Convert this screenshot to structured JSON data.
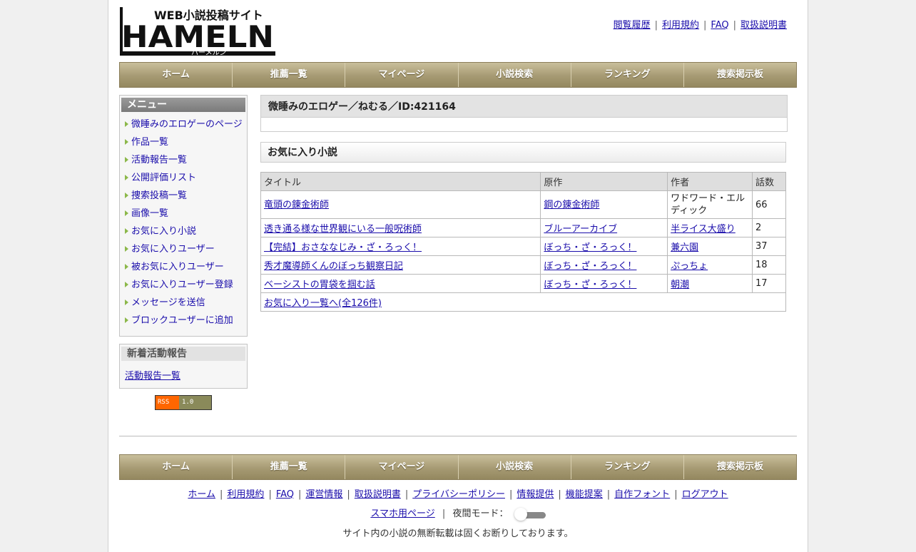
{
  "logo": {
    "sub_text": "WEB小説投稿サイト",
    "main_text": "HAMELN",
    "kana": "ハーメルン"
  },
  "top_links": [
    "閲覧履歴",
    "利用規約",
    "FAQ",
    "取扱説明書"
  ],
  "nav": [
    "ホーム",
    "推薦一覧",
    "マイページ",
    "小説検索",
    "ランキング",
    "捜索掲示板"
  ],
  "sidebar": {
    "menu_title": "メニュー",
    "menu_items": [
      "微睡みのエロゲーのページ",
      "作品一覧",
      "活動報告一覧",
      "公開評価リスト",
      "捜索投稿一覧",
      "画像一覧",
      "お気に入り小説",
      "お気に入りユーザー",
      "被お気に入りユーザー",
      "お気に入りユーザー登録",
      "メッセージを送信",
      "ブロックユーザーに追加"
    ],
    "news_title": "新着活動報告",
    "news_link": "活動報告一覧",
    "rss_left": "RSS",
    "rss_right": "1.0"
  },
  "main": {
    "user_title": "微睡みのエロゲー／ねむる／ID:421164",
    "section_title": "お気に入り小説",
    "table": {
      "headers": [
        "タイトル",
        "原作",
        "作者",
        "話数"
      ],
      "rows": [
        {
          "title": "竜頭の錬金術師",
          "original": "鋼の錬金術師",
          "author": "ワドワード・エルディック",
          "episodes": "66"
        },
        {
          "title": "透き通る様な世界観にいる一般呪術師",
          "original": "ブルーアーカイブ",
          "author": "半ライス大盛り",
          "episodes": "2"
        },
        {
          "title": "【完結】おさななじみ・ざ・ろっく！",
          "original": "ぼっち・ざ・ろっく！",
          "author": "兼六園",
          "episodes": "37"
        },
        {
          "title": "秀才魔導師くんのぼっち観察日記",
          "original": "ぼっち・ざ・ろっく！",
          "author": "ぷっちょ",
          "episodes": "18"
        },
        {
          "title": "ベーシストの胃袋を掴む話",
          "original": "ぼっち・ざ・ろっく！",
          "author": "朝潮",
          "episodes": "17"
        }
      ],
      "more_link": "お気に入り一覧へ(全126件)"
    }
  },
  "footer": {
    "nav": [
      "ホーム",
      "推薦一覧",
      "マイページ",
      "小説検索",
      "ランキング",
      "捜索掲示板"
    ],
    "links": [
      "ホーム",
      "利用規約",
      "FAQ",
      "運営情報",
      "取扱説明書",
      "プライバシーポリシー",
      "情報提供",
      "機能提案",
      "自作フォント",
      "ログアウト"
    ],
    "mobile_link": "スマホ用ページ",
    "night_mode_label": "夜間モード：",
    "notice": "サイト内の小説の無断転載は固くお断りしております。"
  }
}
